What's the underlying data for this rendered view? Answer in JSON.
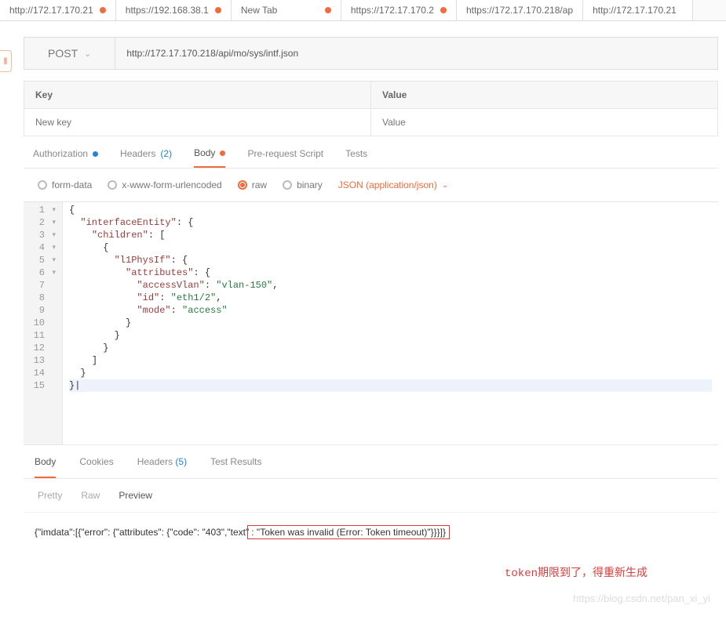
{
  "browserTabs": [
    {
      "label": "http://172.17.170.21",
      "modified": true
    },
    {
      "label": "https://192.168.38.1",
      "modified": true
    },
    {
      "label": "New Tab",
      "modified": true
    },
    {
      "label": "https://172.17.170.2",
      "modified": true
    },
    {
      "label": "https://172.17.170.218/ap",
      "modified": false
    },
    {
      "label": "http://172.17.170.21",
      "modified": false
    }
  ],
  "request": {
    "method": "POST",
    "url": "http://172.17.170.218/api/mo/sys/intf.json"
  },
  "kv": {
    "keyHeader": "Key",
    "valueHeader": "Value",
    "keyPlaceholder": "New key",
    "valuePlaceholder": "Value"
  },
  "subTabs": {
    "authorization": "Authorization",
    "headers": "Headers",
    "headersCount": "(2)",
    "body": "Body",
    "preRequest": "Pre-request Script",
    "tests": "Tests"
  },
  "bodyTypes": {
    "formData": "form-data",
    "urlencoded": "x-www-form-urlencoded",
    "raw": "raw",
    "binary": "binary",
    "contentType": "JSON (application/json)"
  },
  "editor": {
    "lines": [
      {
        "n": 1,
        "fold": true,
        "html": "<span class='p'>{</span>"
      },
      {
        "n": 2,
        "fold": true,
        "html": "  <span class='k'>\"interfaceEntity\"</span><span class='p'>: {</span>"
      },
      {
        "n": 3,
        "fold": true,
        "html": "    <span class='k'>\"children\"</span><span class='p'>: [</span>"
      },
      {
        "n": 4,
        "fold": true,
        "html": "      <span class='p'>{</span>"
      },
      {
        "n": 5,
        "fold": true,
        "html": "        <span class='k'>\"l1PhysIf\"</span><span class='p'>: {</span>"
      },
      {
        "n": 6,
        "fold": true,
        "html": "          <span class='k'>\"attributes\"</span><span class='p'>: {</span>"
      },
      {
        "n": 7,
        "fold": false,
        "html": "            <span class='k'>\"accessVlan\"</span><span class='p'>: </span><span class='s'>\"vlan-150\"</span><span class='p'>,</span>"
      },
      {
        "n": 8,
        "fold": false,
        "html": "            <span class='k'>\"id\"</span><span class='p'>: </span><span class='s'>\"eth1/2\"</span><span class='p'>,</span>"
      },
      {
        "n": 9,
        "fold": false,
        "html": "            <span class='k'>\"mode\"</span><span class='p'>: </span><span class='s'>\"access\"</span>"
      },
      {
        "n": 10,
        "fold": false,
        "html": "          <span class='p'>}</span>"
      },
      {
        "n": 11,
        "fold": false,
        "html": "        <span class='p'>}</span>"
      },
      {
        "n": 12,
        "fold": false,
        "html": "      <span class='p'>}</span>"
      },
      {
        "n": 13,
        "fold": false,
        "html": "    <span class='p'>]</span>"
      },
      {
        "n": 14,
        "fold": false,
        "html": "  <span class='p'>}</span>"
      },
      {
        "n": 15,
        "fold": false,
        "hl": true,
        "html": "<span class='p'>}</span>|"
      }
    ]
  },
  "respTabs": {
    "body": "Body",
    "cookies": "Cookies",
    "headers": "Headers",
    "headersCount": "(5)",
    "testResults": "Test Results"
  },
  "viewTabs": {
    "pretty": "Pretty",
    "raw": "Raw",
    "preview": "Preview"
  },
  "response": {
    "prefix": "{\"imdata\":[{\"error\": {\"attributes\": {\"code\": \"403\",\"text\"",
    "errBox": ": \"Token was invalid (Error: Token timeout)\"}}}]}"
  },
  "annotation": {
    "tokenWord": "token",
    "text": "期限到了，得重新生成"
  },
  "watermark": "https://blog.csdn.net/pan_xi_yi",
  "leftHandle": "‖"
}
